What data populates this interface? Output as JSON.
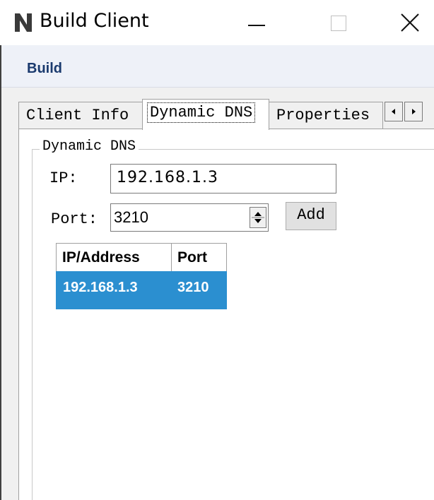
{
  "window": {
    "title": "Build Client",
    "minimize_icon": "minimize-icon",
    "maximize_icon": "maximize-icon",
    "close_icon": "close-icon"
  },
  "menu": {
    "build_label": "Build"
  },
  "tabs": [
    {
      "label": "Client Info",
      "selected": false
    },
    {
      "label": "Dynamic DNS",
      "selected": true
    },
    {
      "label": "Properties",
      "selected": false
    }
  ],
  "group": {
    "title": "Dynamic DNS",
    "ip_label": "IP:",
    "ip_value": "192.168.1.3",
    "port_label": "Port:",
    "port_value": "3210",
    "add_label": "Add"
  },
  "table": {
    "headers": [
      "IP/Address",
      "Port"
    ],
    "rows": [
      {
        "ip": "192.168.1.3",
        "port": "3210",
        "selected": true
      }
    ]
  },
  "colors": {
    "selection": "#2b8fd0",
    "menu_text": "#1a3a6e"
  }
}
